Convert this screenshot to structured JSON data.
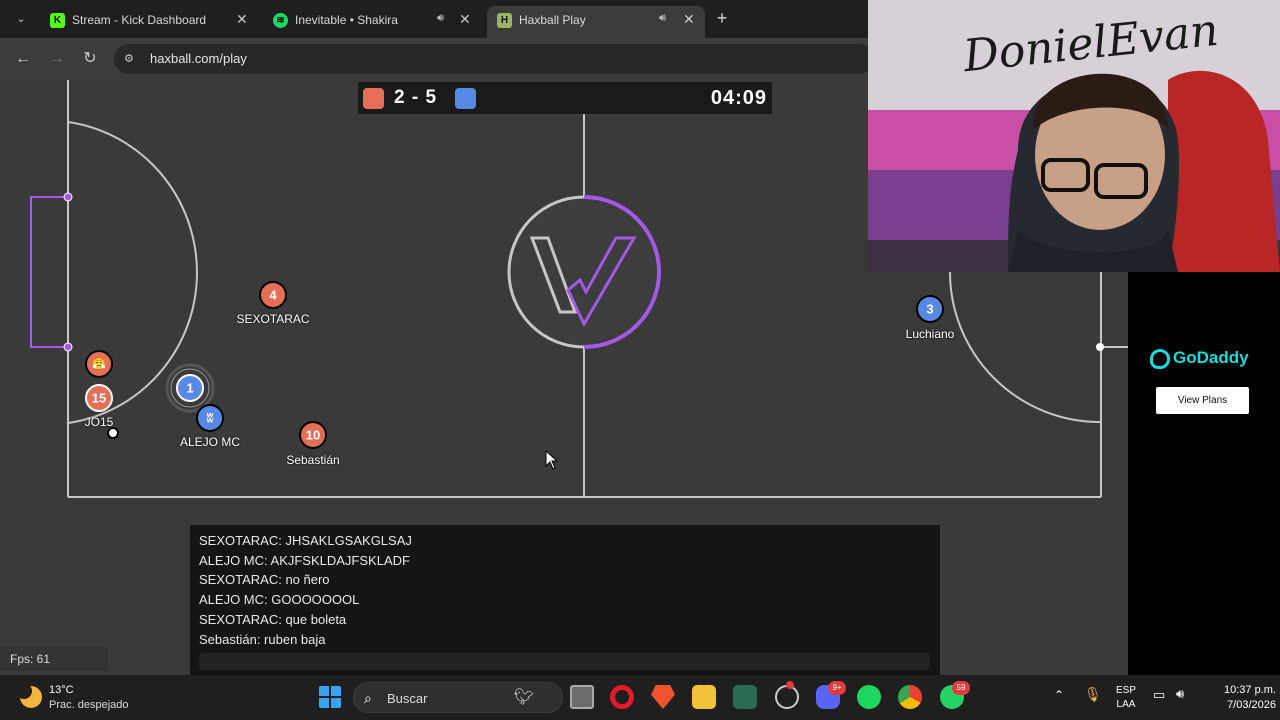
{
  "browser": {
    "tabs": [
      {
        "title": "Stream - Kick Dashboard",
        "favicon_icon": "kick-icon",
        "favicon_color": "#53fc18",
        "active": false
      },
      {
        "title": "Inevitable • Shakira",
        "favicon_icon": "spotify-icon",
        "favicon_color": "#1ed760",
        "active": false,
        "audio": true
      },
      {
        "title": "Haxball Play",
        "favicon_icon": "haxball-icon",
        "favicon_color": "#9bb55f",
        "active": true,
        "audio": true
      }
    ],
    "url": "haxball.com/play"
  },
  "game": {
    "score_red": "2",
    "score_blue": "5",
    "score_text": "2 - 5",
    "timer": "04:09",
    "colors": {
      "red_team": "#e56e56",
      "blue_team": "#5689e5",
      "field": "#3a3a3a",
      "logo_accent": "#a259e6"
    },
    "players": [
      {
        "name": "SEXOTARAC",
        "number": "4",
        "team": "red"
      },
      {
        "name": "Sebastián",
        "number": "10",
        "team": "red"
      },
      {
        "name": "JO15",
        "number": "15",
        "team": "red"
      },
      {
        "name": "",
        "number": "😤",
        "team": "red"
      },
      {
        "name": "",
        "number": "1",
        "team": "blue"
      },
      {
        "name": "ALEJO MC",
        "number": "ʬ",
        "team": "blue"
      },
      {
        "name": "Luchiano",
        "number": "3",
        "team": "blue"
      }
    ],
    "chat": [
      "SEXOTARAC: JHSAKLGSAKGLSAJ",
      "ALEJO MC: AKJFSKLDAJFSKLADF",
      "SEXOTARAC: no ñero",
      "ALEJO MC: GOOOOOOOL",
      "SEXOTARAC: que boleta",
      "Sebastián: ruben baja"
    ],
    "fps": "Fps: 61"
  },
  "overlay": {
    "webcam_graffiti": "DonielEvan",
    "ad_brand": "GoDaddy",
    "ad_button": "View Plans"
  },
  "taskbar": {
    "weather_temp": "13°C",
    "weather_desc": "Prac. despejado",
    "search_placeholder": "Buscar",
    "whatsapp_badge": "59",
    "discord_badge": "9+",
    "lang_top": "ESP",
    "lang_bottom": "LAA",
    "time": "10:37 p.m.",
    "date": "7/03/2026"
  }
}
